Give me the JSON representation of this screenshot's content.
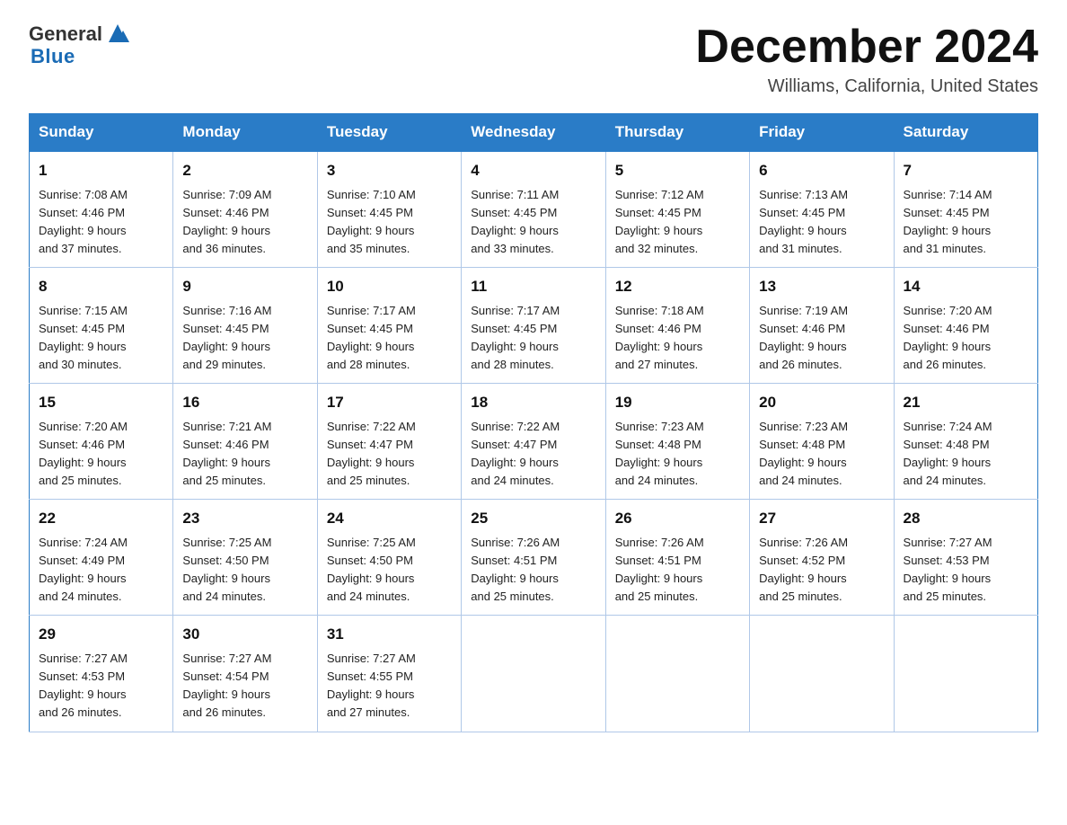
{
  "header": {
    "logo_general": "General",
    "logo_blue": "Blue",
    "calendar_title": "December 2024",
    "calendar_subtitle": "Williams, California, United States"
  },
  "weekdays": [
    "Sunday",
    "Monday",
    "Tuesday",
    "Wednesday",
    "Thursday",
    "Friday",
    "Saturday"
  ],
  "weeks": [
    [
      {
        "day": "1",
        "sunrise": "7:08 AM",
        "sunset": "4:46 PM",
        "daylight": "9 hours and 37 minutes."
      },
      {
        "day": "2",
        "sunrise": "7:09 AM",
        "sunset": "4:46 PM",
        "daylight": "9 hours and 36 minutes."
      },
      {
        "day": "3",
        "sunrise": "7:10 AM",
        "sunset": "4:45 PM",
        "daylight": "9 hours and 35 minutes."
      },
      {
        "day": "4",
        "sunrise": "7:11 AM",
        "sunset": "4:45 PM",
        "daylight": "9 hours and 33 minutes."
      },
      {
        "day": "5",
        "sunrise": "7:12 AM",
        "sunset": "4:45 PM",
        "daylight": "9 hours and 32 minutes."
      },
      {
        "day": "6",
        "sunrise": "7:13 AM",
        "sunset": "4:45 PM",
        "daylight": "9 hours and 31 minutes."
      },
      {
        "day": "7",
        "sunrise": "7:14 AM",
        "sunset": "4:45 PM",
        "daylight": "9 hours and 31 minutes."
      }
    ],
    [
      {
        "day": "8",
        "sunrise": "7:15 AM",
        "sunset": "4:45 PM",
        "daylight": "9 hours and 30 minutes."
      },
      {
        "day": "9",
        "sunrise": "7:16 AM",
        "sunset": "4:45 PM",
        "daylight": "9 hours and 29 minutes."
      },
      {
        "day": "10",
        "sunrise": "7:17 AM",
        "sunset": "4:45 PM",
        "daylight": "9 hours and 28 minutes."
      },
      {
        "day": "11",
        "sunrise": "7:17 AM",
        "sunset": "4:45 PM",
        "daylight": "9 hours and 28 minutes."
      },
      {
        "day": "12",
        "sunrise": "7:18 AM",
        "sunset": "4:46 PM",
        "daylight": "9 hours and 27 minutes."
      },
      {
        "day": "13",
        "sunrise": "7:19 AM",
        "sunset": "4:46 PM",
        "daylight": "9 hours and 26 minutes."
      },
      {
        "day": "14",
        "sunrise": "7:20 AM",
        "sunset": "4:46 PM",
        "daylight": "9 hours and 26 minutes."
      }
    ],
    [
      {
        "day": "15",
        "sunrise": "7:20 AM",
        "sunset": "4:46 PM",
        "daylight": "9 hours and 25 minutes."
      },
      {
        "day": "16",
        "sunrise": "7:21 AM",
        "sunset": "4:46 PM",
        "daylight": "9 hours and 25 minutes."
      },
      {
        "day": "17",
        "sunrise": "7:22 AM",
        "sunset": "4:47 PM",
        "daylight": "9 hours and 25 minutes."
      },
      {
        "day": "18",
        "sunrise": "7:22 AM",
        "sunset": "4:47 PM",
        "daylight": "9 hours and 24 minutes."
      },
      {
        "day": "19",
        "sunrise": "7:23 AM",
        "sunset": "4:48 PM",
        "daylight": "9 hours and 24 minutes."
      },
      {
        "day": "20",
        "sunrise": "7:23 AM",
        "sunset": "4:48 PM",
        "daylight": "9 hours and 24 minutes."
      },
      {
        "day": "21",
        "sunrise": "7:24 AM",
        "sunset": "4:48 PM",
        "daylight": "9 hours and 24 minutes."
      }
    ],
    [
      {
        "day": "22",
        "sunrise": "7:24 AM",
        "sunset": "4:49 PM",
        "daylight": "9 hours and 24 minutes."
      },
      {
        "day": "23",
        "sunrise": "7:25 AM",
        "sunset": "4:50 PM",
        "daylight": "9 hours and 24 minutes."
      },
      {
        "day": "24",
        "sunrise": "7:25 AM",
        "sunset": "4:50 PM",
        "daylight": "9 hours and 24 minutes."
      },
      {
        "day": "25",
        "sunrise": "7:26 AM",
        "sunset": "4:51 PM",
        "daylight": "9 hours and 25 minutes."
      },
      {
        "day": "26",
        "sunrise": "7:26 AM",
        "sunset": "4:51 PM",
        "daylight": "9 hours and 25 minutes."
      },
      {
        "day": "27",
        "sunrise": "7:26 AM",
        "sunset": "4:52 PM",
        "daylight": "9 hours and 25 minutes."
      },
      {
        "day": "28",
        "sunrise": "7:27 AM",
        "sunset": "4:53 PM",
        "daylight": "9 hours and 25 minutes."
      }
    ],
    [
      {
        "day": "29",
        "sunrise": "7:27 AM",
        "sunset": "4:53 PM",
        "daylight": "9 hours and 26 minutes."
      },
      {
        "day": "30",
        "sunrise": "7:27 AM",
        "sunset": "4:54 PM",
        "daylight": "9 hours and 26 minutes."
      },
      {
        "day": "31",
        "sunrise": "7:27 AM",
        "sunset": "4:55 PM",
        "daylight": "9 hours and 27 minutes."
      },
      null,
      null,
      null,
      null
    ]
  ],
  "labels": {
    "sunrise": "Sunrise:",
    "sunset": "Sunset:",
    "daylight": "Daylight:"
  }
}
